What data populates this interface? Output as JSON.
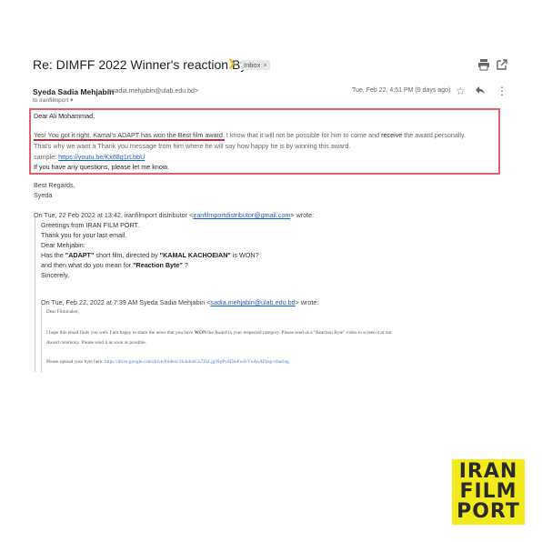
{
  "header": {
    "subject": "Re: DIMFF 2022 Winner's reaction Byte",
    "label": "Inbox",
    "label_close": "×"
  },
  "sender": {
    "name": "Syeda Sadia Mehjabin",
    "email": "<sadia.mehjabin@ulab.edu.bd>",
    "to": "to iranfilmport ▾",
    "date": "Tue, Feb 22, 4:51 PM (9 days ago)"
  },
  "body": {
    "greeting": "Dear Ali Mohammad,",
    "line2_underlined": "Yes! You got it right. Kamal's ADAPT has won the Best film award.",
    "line2_rest_a": " I know that it will not be possible for him to come and ",
    "line2_strong": "receive",
    "line2_rest_b": " the award personally.",
    "line3": "That's why we want a Thank you message from him where he will say how happy he is by winning this award.",
    "line4_prefix": "sample: ",
    "line4_link": "https://youtu.be/Kx68g1rLbbU",
    "line5": "If you have any questions, please let me know.",
    "regards": "Best Regards,",
    "signature": "Syeda"
  },
  "quote1": {
    "header_prefix": "On Tue, 22 Feb 2022 at 13:42, iranfilmport distributor <",
    "header_link": "iranfilmportdistributor@gmail.com",
    "header_suffix": "> wrote:",
    "line1": "Greetings from IRAN FILM PORT.",
    "line2": "Thank you for your last email.",
    "line3": "Dear Mehjabin:",
    "line4_a": "Has the ",
    "line4_b": "\"ADAPT\"",
    "line4_c": " short film, directed by ",
    "line4_d": "\"KAMAL KACHOEIAN\"",
    "line4_e": " is WON?",
    "line5_a": "and then what do you mean for ",
    "line5_b": "\"Reaction Byte\"",
    "line5_c": " ?",
    "line6": "Sincerely,"
  },
  "quote2": {
    "header_prefix": "On Tue, Feb 22, 2022 at 7:39 AM Syeda Sadia Mehjabin <",
    "header_link": "sadia.mehjabin@ulab.edu.bd",
    "header_suffix": "> wrote:",
    "line1": "Dear Filmmaker,",
    "line2_a": "I hope this email finds you well. I am happy to share the news that you have ",
    "line2_b": "WON",
    "line2_c": " the Award in your respected category. Please send us a \"Reaction Byte\"  video to screen it at our",
    "line3": "Award ceremony. Please send it as soon as possible.",
    "line4_prefix": "Please upload your byte here: ",
    "line4_link": "https://drive.google.com/drive/folders/1S4ukmCh7ZzLjgiNpPvSDmFwSrVnAnAPusp=sharing"
  },
  "logo": {
    "line1": "IRAN",
    "line2": "FILM",
    "line3": "PORT"
  },
  "colors": {
    "highlight_border": "#e06070",
    "underline": "#cf2b3f",
    "link": "#1a5dc8",
    "logo_bg": "#f2ea1a"
  }
}
